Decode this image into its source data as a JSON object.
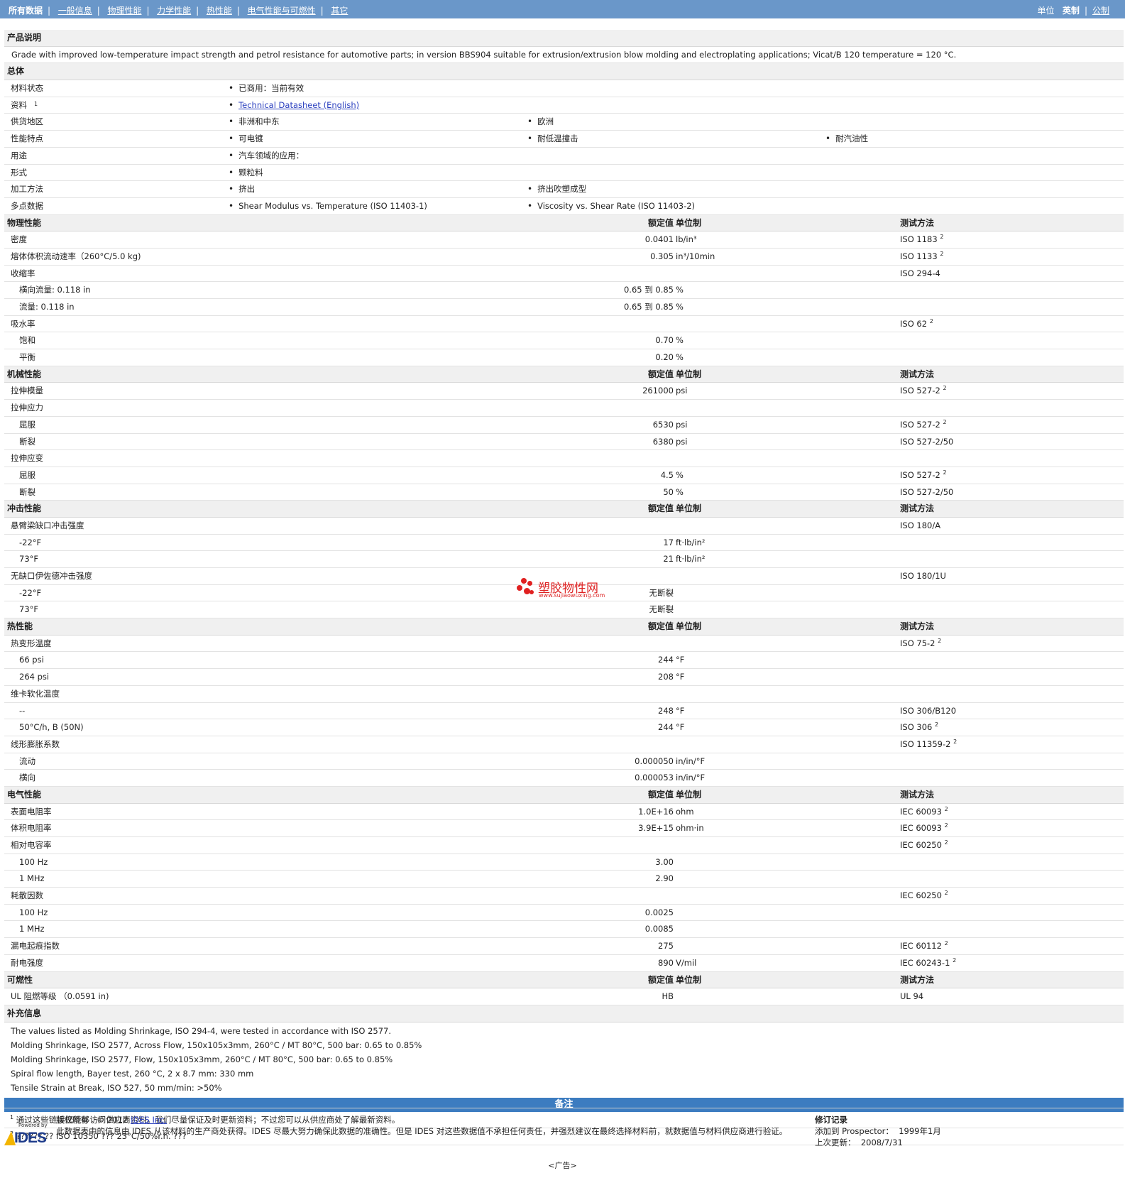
{
  "nav": {
    "items": [
      "所有数据",
      "一般信息",
      "物理性能",
      "力学性能",
      "热性能",
      "电气性能与可燃性",
      "其它"
    ],
    "units_label": "单位",
    "unit_imperial": "英制",
    "unit_metric": "公制"
  },
  "headers": {
    "value": "额定值",
    "unit": "单位制",
    "method": "测试方法"
  },
  "product": {
    "title": "产品说明",
    "text": "Grade with improved low-temperature impact strength and petrol resistance for automotive parts; in version BBS904 suitable for extrusion/extrusion blow molding and electroplating applications; Vicat/B 120 temperature = 120 °C."
  },
  "general": {
    "title": "总体",
    "rows": [
      {
        "label": "材料状态",
        "sup": "",
        "items": [
          "已商用：当前有效"
        ],
        "link": false
      },
      {
        "label": "资料",
        "sup": "1",
        "items": [
          "Technical Datasheet (English)"
        ],
        "link": true
      },
      {
        "label": "供货地区",
        "sup": "",
        "items": [
          "非洲和中东",
          "欧洲"
        ],
        "link": false
      },
      {
        "label": "性能特点",
        "sup": "",
        "items": [
          "可电镀",
          "耐低温撞击",
          "耐汽油性"
        ],
        "link": false
      },
      {
        "label": "用途",
        "sup": "",
        "items": [
          "汽车领域的应用："
        ],
        "link": false
      },
      {
        "label": "形式",
        "sup": "",
        "items": [
          "颗粒料"
        ],
        "link": false
      },
      {
        "label": "加工方法",
        "sup": "",
        "items": [
          "挤出",
          "挤出吹塑成型"
        ],
        "link": false
      },
      {
        "label": "多点数据",
        "sup": "",
        "items": [
          "Shear Modulus vs. Temperature (ISO 11403-1)",
          "Viscosity vs. Shear Rate (ISO 11403-2)"
        ],
        "link": false
      }
    ]
  },
  "sections": [
    {
      "title": "物理性能",
      "rows": [
        {
          "label": "密度",
          "sub": false,
          "value": "0.0401",
          "unit": "lb/in³",
          "method": "ISO 1183",
          "msup": "2"
        },
        {
          "label": "熔体体积流动速率（260°C/5.0 kg)",
          "sub": false,
          "value": "0.305",
          "unit": "in³/10min",
          "method": "ISO 1133",
          "msup": "2"
        },
        {
          "label": "收缩率",
          "sub": false,
          "value": "",
          "unit": "",
          "method": "ISO 294-4",
          "msup": ""
        },
        {
          "label": "横向流量: 0.118 in",
          "sub": true,
          "value": "0.65 到  0.85",
          "unit": "%",
          "method": "",
          "msup": ""
        },
        {
          "label": "流量: 0.118 in",
          "sub": true,
          "value": "0.65 到  0.85",
          "unit": "%",
          "method": "",
          "msup": ""
        },
        {
          "label": "吸水率",
          "sub": false,
          "value": "",
          "unit": "",
          "method": "ISO 62",
          "msup": "2"
        },
        {
          "label": "饱和",
          "sub": true,
          "value": "0.70",
          "unit": "%",
          "method": "",
          "msup": ""
        },
        {
          "label": "平衡",
          "sub": true,
          "value": "0.20",
          "unit": "%",
          "method": "",
          "msup": ""
        }
      ]
    },
    {
      "title": "机械性能",
      "rows": [
        {
          "label": "拉伸模量",
          "sub": false,
          "value": "261000",
          "unit": "psi",
          "method": "ISO 527-2",
          "msup": "2"
        },
        {
          "label": "拉伸应力",
          "sub": false,
          "value": "",
          "unit": "",
          "method": "",
          "msup": ""
        },
        {
          "label": "屈服",
          "sub": true,
          "value": "6530",
          "unit": "psi",
          "method": "ISO 527-2",
          "msup": "2"
        },
        {
          "label": "断裂",
          "sub": true,
          "value": "6380",
          "unit": "psi",
          "method": "ISO 527-2/50",
          "msup": ""
        },
        {
          "label": "拉伸应变",
          "sub": false,
          "value": "",
          "unit": "",
          "method": "",
          "msup": ""
        },
        {
          "label": "屈服",
          "sub": true,
          "value": "4.5",
          "unit": "%",
          "method": "ISO 527-2",
          "msup": "2"
        },
        {
          "label": "断裂",
          "sub": true,
          "value": "50",
          "unit": "%",
          "method": "ISO 527-2/50",
          "msup": ""
        }
      ]
    },
    {
      "title": "冲击性能",
      "rows": [
        {
          "label": "悬臂梁缺口冲击强度",
          "sub": false,
          "value": "",
          "unit": "",
          "method": "ISO 180/A",
          "msup": ""
        },
        {
          "label": "-22°F",
          "sub": true,
          "value": "17",
          "unit": "ft·lb/in²",
          "method": "",
          "msup": ""
        },
        {
          "label": "73°F",
          "sub": true,
          "value": "21",
          "unit": "ft·lb/in²",
          "method": "",
          "msup": ""
        },
        {
          "label": "无缺口伊佐德冲击强度",
          "sub": false,
          "value": "",
          "unit": "",
          "method": "ISO 180/1U",
          "msup": ""
        },
        {
          "label": "-22°F",
          "sub": true,
          "value": "无断裂",
          "unit": "",
          "method": "",
          "msup": ""
        },
        {
          "label": "73°F",
          "sub": true,
          "value": "无断裂",
          "unit": "",
          "method": "",
          "msup": ""
        }
      ]
    },
    {
      "title": "热性能",
      "rows": [
        {
          "label": "热变形温度",
          "sub": false,
          "value": "",
          "unit": "",
          "method": "ISO 75-2",
          "msup": "2"
        },
        {
          "label": "66 psi",
          "sub": true,
          "value": "244",
          "unit": "°F",
          "method": "",
          "msup": ""
        },
        {
          "label": "264 psi",
          "sub": true,
          "value": "208",
          "unit": "°F",
          "method": "",
          "msup": ""
        },
        {
          "label": "维卡软化温度",
          "sub": false,
          "value": "",
          "unit": "",
          "method": "",
          "msup": ""
        },
        {
          "label": "--",
          "sub": true,
          "value": "248",
          "unit": "°F",
          "method": "ISO 306/B120",
          "msup": ""
        },
        {
          "label": "50°C/h, B (50N)",
          "sub": true,
          "value": "244",
          "unit": "°F",
          "method": "ISO 306",
          "msup": "2"
        },
        {
          "label": "线形膨胀系数",
          "sub": false,
          "value": "",
          "unit": "",
          "method": "ISO 11359-2",
          "msup": "2"
        },
        {
          "label": "流动",
          "sub": true,
          "value": "0.000050",
          "unit": "in/in/°F",
          "method": "",
          "msup": ""
        },
        {
          "label": "横向",
          "sub": true,
          "value": "0.000053",
          "unit": "in/in/°F",
          "method": "",
          "msup": ""
        }
      ]
    },
    {
      "title": "电气性能",
      "rows": [
        {
          "label": "表面电阻率",
          "sub": false,
          "value": "1.0E+16",
          "unit": "ohm",
          "method": "IEC 60093",
          "msup": "2"
        },
        {
          "label": "体积电阻率",
          "sub": false,
          "value": "3.9E+15",
          "unit": "ohm·in",
          "method": "IEC 60093",
          "msup": "2"
        },
        {
          "label": "相对电容率",
          "sub": false,
          "value": "",
          "unit": "",
          "method": "IEC 60250",
          "msup": "2"
        },
        {
          "label": "100 Hz",
          "sub": true,
          "value": "3.00",
          "unit": "",
          "method": "",
          "msup": ""
        },
        {
          "label": "1 MHz",
          "sub": true,
          "value": "2.90",
          "unit": "",
          "method": "",
          "msup": ""
        },
        {
          "label": "耗散因数",
          "sub": false,
          "value": "",
          "unit": "",
          "method": "IEC 60250",
          "msup": "2"
        },
        {
          "label": "100 Hz",
          "sub": true,
          "value": "0.0025",
          "unit": "",
          "method": "",
          "msup": ""
        },
        {
          "label": "1 MHz",
          "sub": true,
          "value": "0.0085",
          "unit": "",
          "method": "",
          "msup": ""
        },
        {
          "label": "漏电起痕指数",
          "sub": false,
          "value": "275",
          "unit": "",
          "method": "IEC 60112",
          "msup": "2"
        },
        {
          "label": "耐电强度",
          "sub": false,
          "value": "890",
          "unit": "V/mil",
          "method": "IEC 60243-1",
          "msup": "2"
        }
      ]
    },
    {
      "title": "可燃性",
      "rows": [
        {
          "label": "UL 阻燃等级 （0.0591 in)",
          "sub": false,
          "value": "HB",
          "unit": "",
          "method": "UL 94",
          "msup": ""
        }
      ]
    }
  ],
  "supplemental": {
    "title": "补充信息",
    "lines": [
      "The values listed as Molding Shrinkage, ISO 294-4, were tested in accordance with ISO 2577.",
      "Molding Shrinkage, ISO 2577, Across Flow, 150x105x3mm, 260°C / MT 80°C, 500 bar: 0.65 to 0.85%",
      "Molding Shrinkage, ISO 2577, Flow, 150x105x3mm, 260°C / MT 80°C, 500 bar: 0.65 to 0.85%",
      "Spiral flow length, Bayer test, 260 °C, 2 x 8.7 mm: 330 mm",
      "Tensile Strain at Break, ISO 527, 50 mm/min: >50%"
    ]
  },
  "notes": {
    "title": "备注",
    "items": [
      {
        "sup": "1",
        "text": "通过这些链接您能够访问供应商资料。我们尽量保证及时更新资料；不过您可以从供应商处了解最新资料。"
      },
      {
        "sup": "2",
        "text": "??????,?? ISO 10350 ??? 23°C/50%r.h. ???"
      }
    ]
  },
  "footer": {
    "powered_by": "Powered by",
    "logo_text": "IDES",
    "copyright_label": "版权所有",
    "copyright_year": "© 2012",
    "company": "IDES Inc.",
    "disclaimer": "此数据表中的信息由 IDES 从该材料的生产商处获得。IDES 尽最大努力确保此数据的准确性。但是 IDES 对这些数据值不承担任何责任，并强烈建议在最终选择材料前，就数据值与材料供应商进行验证。",
    "revision_title": "修订记录",
    "added_label": "添加到 Prospector：",
    "added_value": "1999年1月",
    "updated_label": "上次更新：",
    "updated_value": "2008/7/31",
    "ad": "<广告>"
  },
  "watermark": {
    "cn": "塑胶物性网",
    "en": "www.sujiaowuxing.com"
  }
}
